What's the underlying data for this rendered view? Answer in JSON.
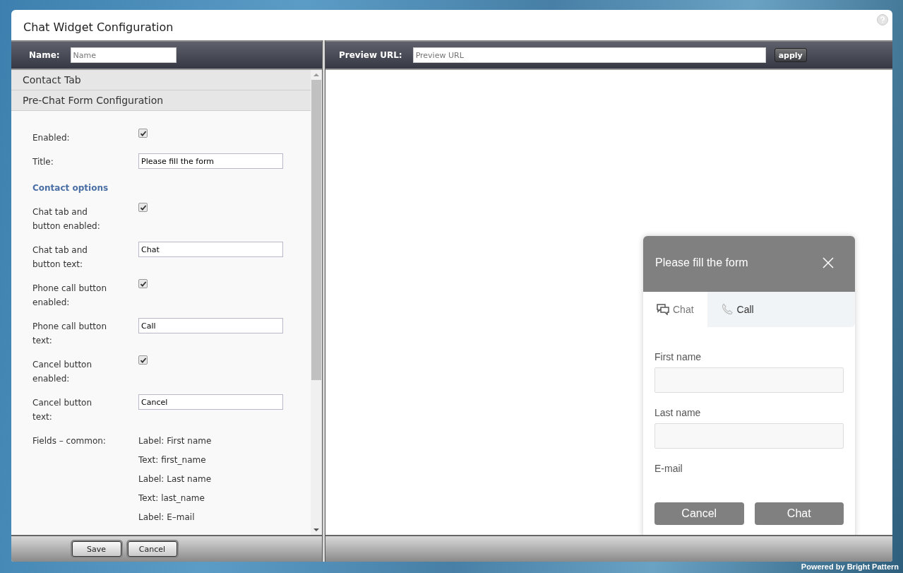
{
  "window": {
    "title": "Chat Widget Configuration"
  },
  "toolbar": {
    "name_label": "Name:",
    "name_placeholder": "Name",
    "preview_label": "Preview URL:",
    "preview_placeholder": "Preview URL",
    "apply_button": "apply"
  },
  "sections": [
    "Contact Tab",
    "Pre-Chat Form Configuration"
  ],
  "form": [
    {
      "kind": "checkbox",
      "label": "Enabled:",
      "checked": true
    },
    {
      "kind": "text",
      "label": "Title:",
      "value": "Please fill the form"
    },
    {
      "kind": "heading",
      "label": "Contact options"
    },
    {
      "kind": "checkbox",
      "label": "Chat tab and button enabled:",
      "checked": true
    },
    {
      "kind": "text",
      "label": "Chat tab and button text:",
      "value": "Chat"
    },
    {
      "kind": "checkbox",
      "label": "Phone call button enabled:",
      "checked": true
    },
    {
      "kind": "text",
      "label": "Phone call button text:",
      "value": "Call"
    },
    {
      "kind": "checkbox",
      "label": "Cancel button enabled:",
      "checked": true
    },
    {
      "kind": "text",
      "label": "Cancel button text:",
      "value": "Cancel"
    },
    {
      "kind": "list",
      "label": "Fields – common:",
      "items": [
        "Label: First name",
        "Text: first_name",
        "Label: Last name",
        "Text: last_name",
        "Label: E–mail"
      ]
    }
  ],
  "footer_buttons": [
    "Save",
    "Cancel"
  ],
  "widget": {
    "title": "Please fill the form",
    "tabs": [
      {
        "label": "Chat",
        "kind": "chat",
        "selected": true
      },
      {
        "label": "Call",
        "kind": "phone",
        "selected": false
      }
    ],
    "fields": [
      "First name",
      "Last name",
      "E-mail"
    ],
    "buttons": [
      "Cancel",
      "Chat"
    ]
  },
  "powered_by": "Powered by Bright Pattern"
}
